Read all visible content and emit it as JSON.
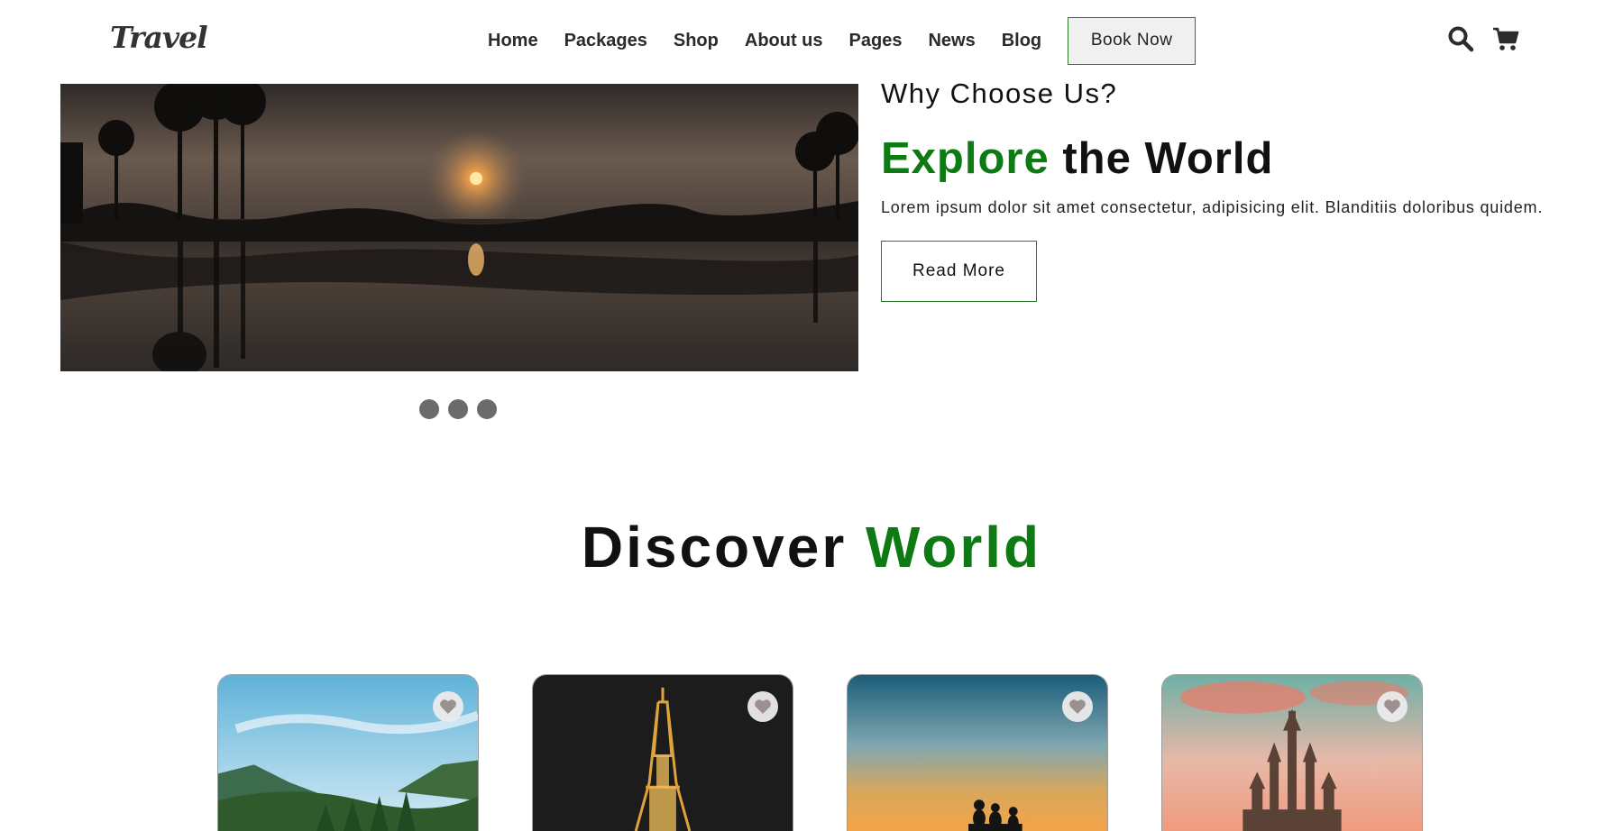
{
  "header": {
    "logo": "Travel",
    "nav": [
      "Home",
      "Packages",
      "Shop",
      "About us",
      "Pages",
      "News",
      "Blog"
    ],
    "book_label": "Book Now",
    "icons": [
      "search-icon",
      "cart-icon"
    ]
  },
  "hero": {
    "subtitle": "Why Choose Us?",
    "title_accent": "Explore",
    "title_rest": "the World",
    "text": "Lorem ipsum dolor sit amet consectetur, adipisicing elit. Blanditiis doloribus quidem.",
    "button_label": "Read More",
    "slide_count": 3
  },
  "discover": {
    "title_main": "Discover",
    "title_accent": "World",
    "cards": [
      {
        "image": "mountain-lake",
        "favorite_icon": "heart-icon"
      },
      {
        "image": "eiffel-tower-night",
        "favorite_icon": "heart-icon"
      },
      {
        "image": "sunset-silhouettes",
        "favorite_icon": "heart-icon"
      },
      {
        "image": "cathedral-sunset",
        "favorite_icon": "heart-icon"
      }
    ]
  },
  "colors": {
    "accent_green": "#0e7a13",
    "border_green": "#2a7a2a",
    "dot_gray": "#6b6b6b"
  }
}
